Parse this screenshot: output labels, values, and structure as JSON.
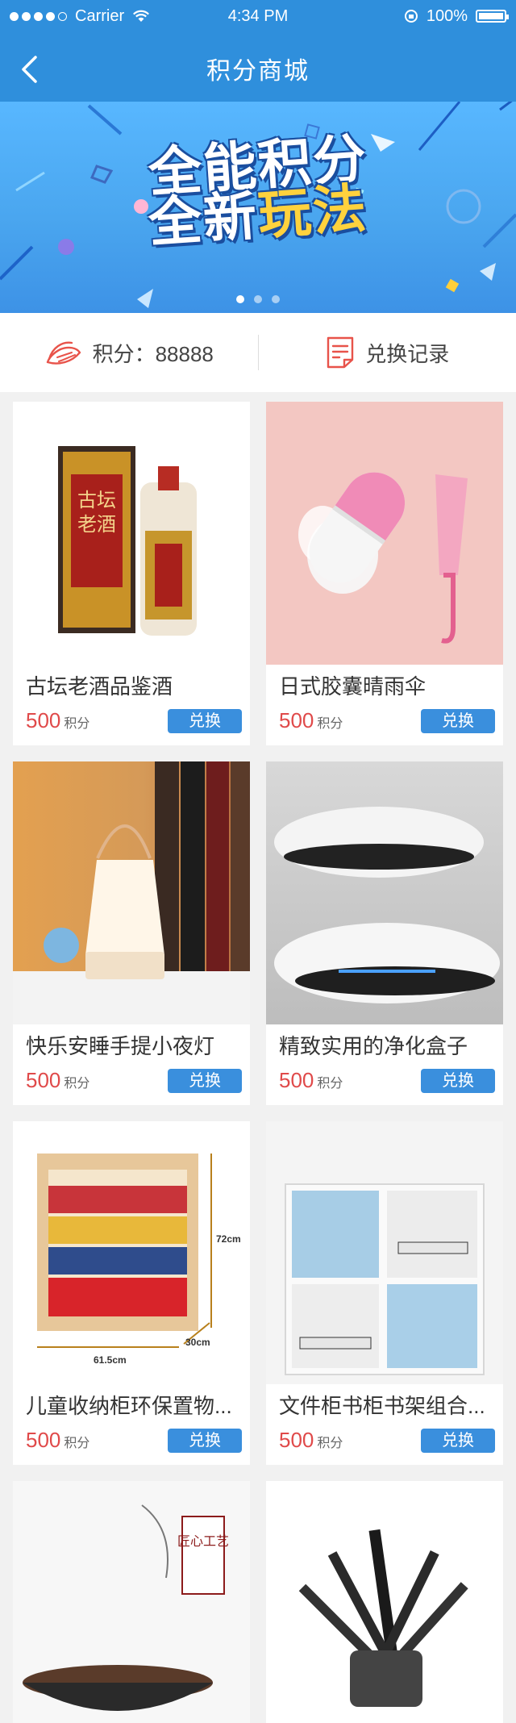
{
  "status_bar": {
    "carrier": "Carrier",
    "time": "4:34 PM",
    "battery": "100%"
  },
  "nav": {
    "title": "积分商城"
  },
  "banner": {
    "line1": "全能积分",
    "line2_a": "全新",
    "line2_b": "玩法",
    "pages": 3,
    "active_page": 0
  },
  "points": {
    "label": "积分：88888",
    "records_label": "兑换记录"
  },
  "products": [
    {
      "name": "古坛老酒品鉴酒",
      "price": "500",
      "unit": "积分",
      "button": "兑换",
      "image": "liquor"
    },
    {
      "name": "日式胶囊晴雨伞",
      "price": "500",
      "unit": "积分",
      "button": "兑换",
      "image": "umbrella"
    },
    {
      "name": "快乐安睡手提小夜灯",
      "price": "500",
      "unit": "积分",
      "button": "兑换",
      "image": "lamp"
    },
    {
      "name": "精致实用的净化盒子",
      "price": "500",
      "unit": "积分",
      "button": "兑换",
      "image": "purifier"
    },
    {
      "name": "儿童收纳柜环保置物...",
      "price": "500",
      "unit": "积分",
      "button": "兑换",
      "image": "shelf"
    },
    {
      "name": "文件柜书柜书架组合...",
      "price": "500",
      "unit": "积分",
      "button": "兑换",
      "image": "cabinet"
    }
  ],
  "shelf_dims": {
    "height": "72cm",
    "depth": "30cm",
    "width": "61.5cm"
  },
  "partial_products": [
    {
      "image": "wok",
      "seal": "匠心工艺"
    },
    {
      "image": "knife-set"
    }
  ]
}
